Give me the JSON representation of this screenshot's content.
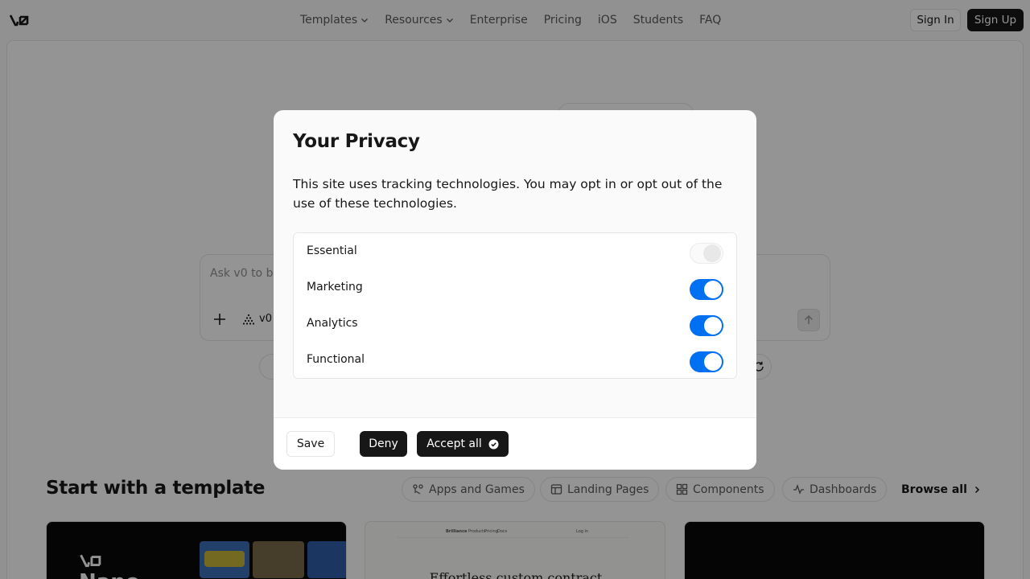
{
  "nav": {
    "logo": "v0-logo-icon",
    "links": [
      {
        "label": "Templates",
        "dropdown": true
      },
      {
        "label": "Resources",
        "dropdown": true
      },
      {
        "label": "Enterprise",
        "dropdown": false
      },
      {
        "label": "Pricing",
        "dropdown": false
      },
      {
        "label": "iOS",
        "dropdown": false
      },
      {
        "label": "Students",
        "dropdown": false
      },
      {
        "label": "FAQ",
        "dropdown": false
      }
    ],
    "sign_in": "Sign In",
    "sign_up": "Sign Up"
  },
  "prompt": {
    "placeholder": "Ask v0 to b",
    "model_label": "v0"
  },
  "templates": {
    "title": "Start with a template",
    "filters": [
      {
        "label": "Apps and Games",
        "icon": "apps-icon"
      },
      {
        "label": "Landing Pages",
        "icon": "layout-icon"
      },
      {
        "label": "Components",
        "icon": "grid-icon"
      },
      {
        "label": "Dashboards",
        "icon": "activity-icon"
      }
    ],
    "browse_all": "Browse all",
    "cards": [
      {
        "title": "Nano"
      },
      {
        "brand": "Brilliance",
        "nav": [
          "Products",
          "Pricing",
          "Docs"
        ],
        "nav_action": "Log in",
        "headline": "Effortless custom contract"
      },
      {
        "title": ""
      }
    ]
  },
  "privacy_modal": {
    "title": "Your Privacy",
    "description": "This site uses tracking technologies. You may opt in or opt out of the use of these technologies.",
    "preferences": [
      {
        "label": "Essential",
        "enabled": true,
        "locked": true
      },
      {
        "label": "Marketing",
        "enabled": true,
        "locked": false
      },
      {
        "label": "Analytics",
        "enabled": true,
        "locked": false
      },
      {
        "label": "Functional",
        "enabled": true,
        "locked": false
      }
    ],
    "buttons": {
      "save": "Save",
      "deny": "Deny",
      "accept_all": "Accept all"
    }
  },
  "colors": {
    "accent": "#0070f3",
    "primary_button": "#171717",
    "overlay": "rgba(0,0,0,0.42)"
  }
}
